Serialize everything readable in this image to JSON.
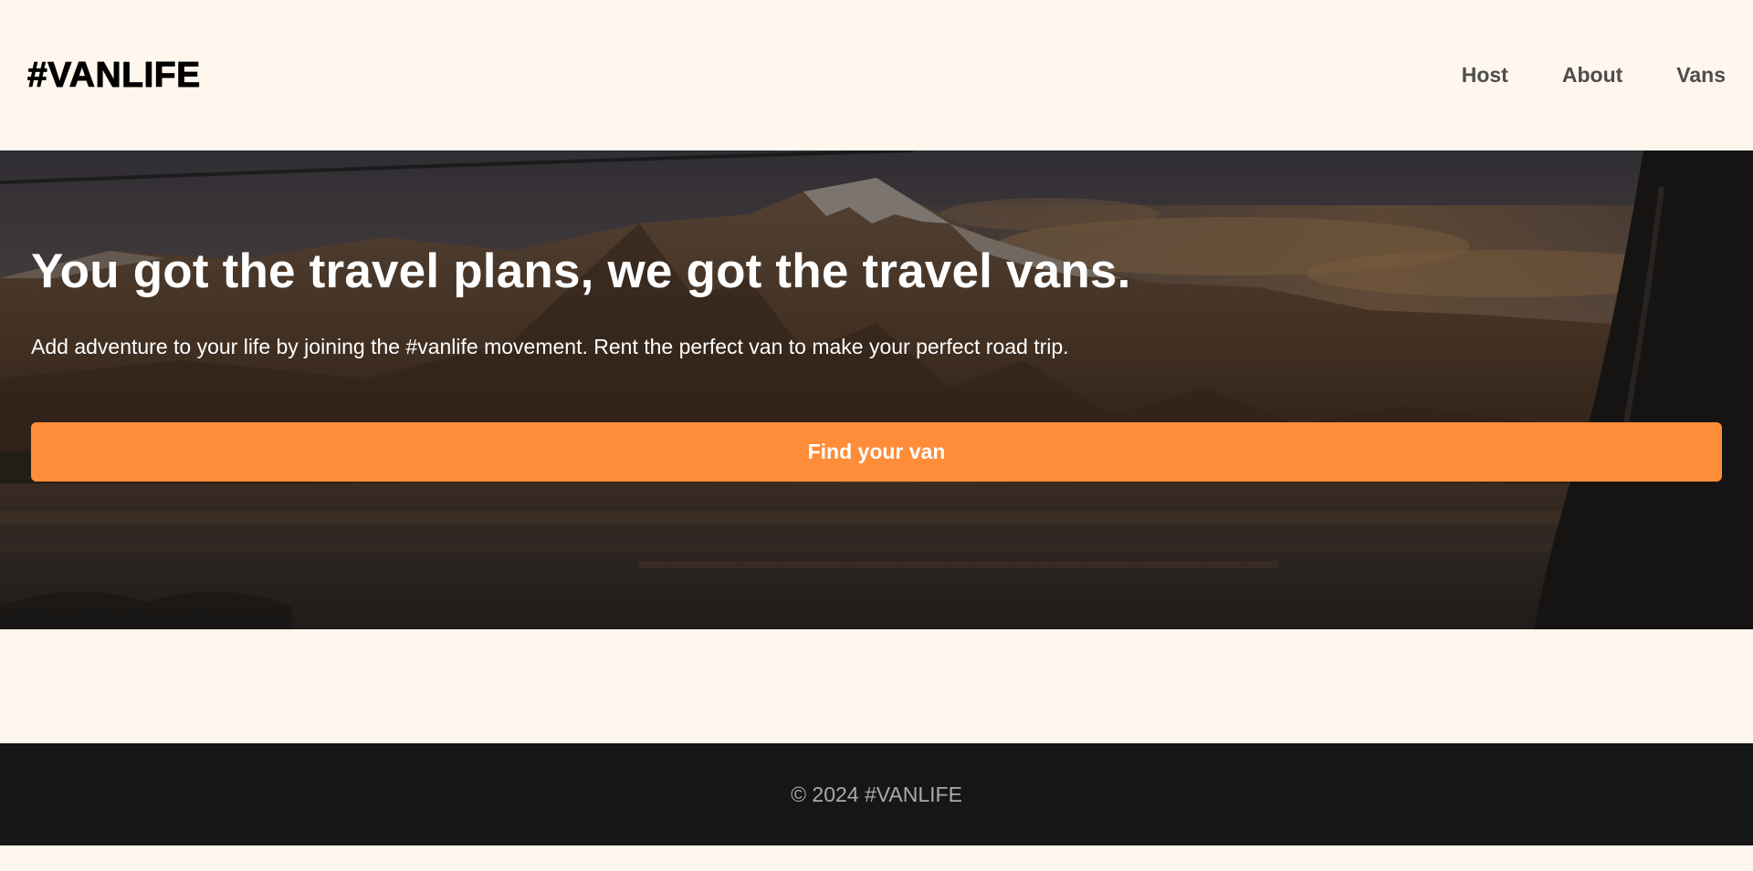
{
  "header": {
    "logo": "#VANLIFE",
    "nav": [
      {
        "label": "Host"
      },
      {
        "label": "About"
      },
      {
        "label": "Vans"
      }
    ]
  },
  "hero": {
    "title": "You got the travel plans, we got the travel vans.",
    "subtitle": "Add adventure to your life by joining the #vanlife movement. Rent the perfect van to make your perfect road trip.",
    "cta_label": "Find your van",
    "background": "mountain-lake-sunset-image"
  },
  "footer": {
    "copyright": "© 2024 #VANLIFE"
  },
  "colors": {
    "page_background": "#FFF7ED",
    "accent": "#FF8C38",
    "footer_background": "#161616",
    "footer_text": "#AAAAAA",
    "nav_text": "#4D4D4D"
  }
}
